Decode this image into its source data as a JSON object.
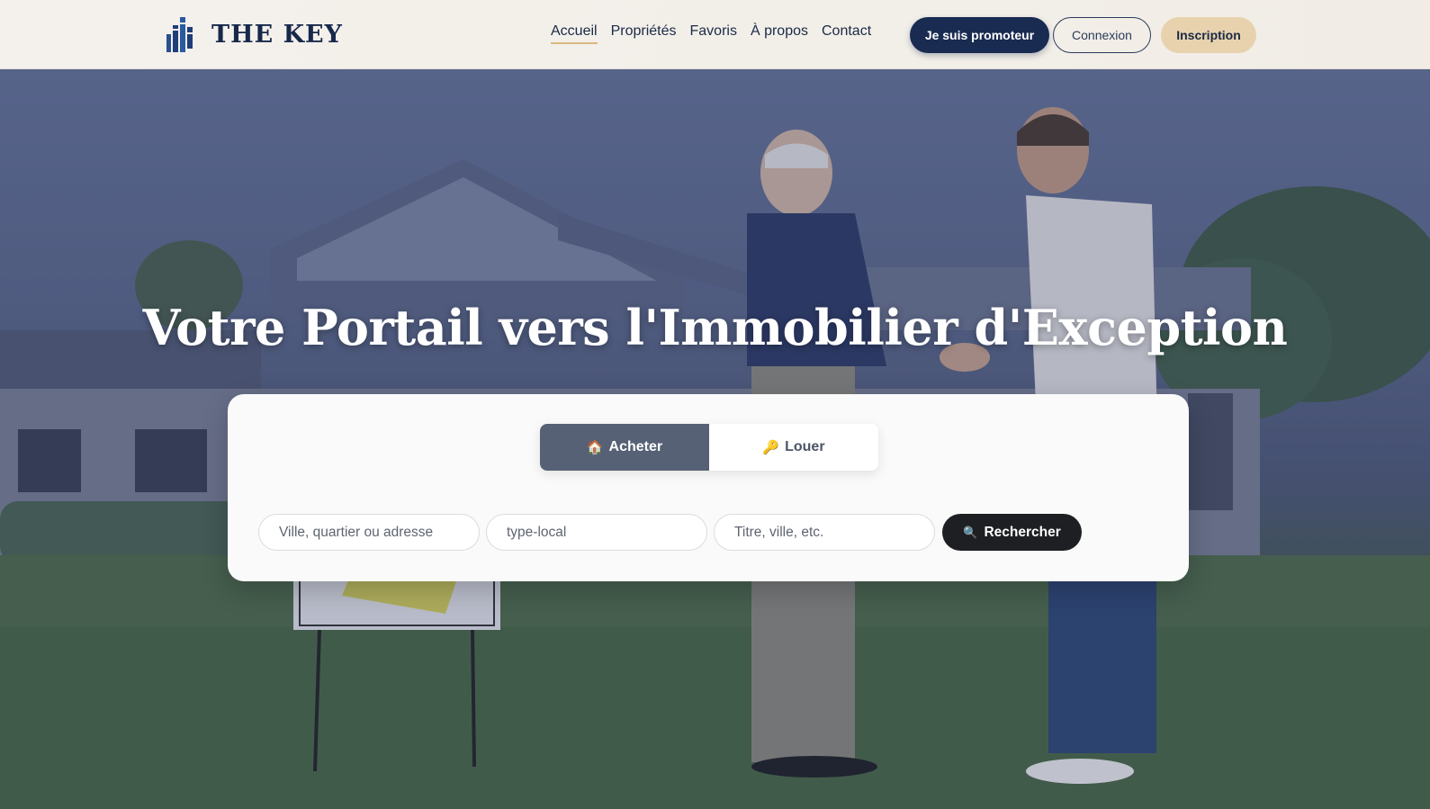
{
  "brand": {
    "name": "THE KEY",
    "icon": "building-logo-icon"
  },
  "nav": {
    "items": [
      {
        "label": "Accueil",
        "active": true
      },
      {
        "label": "Propriétés",
        "active": false
      },
      {
        "label": "Favoris",
        "active": false
      },
      {
        "label": "À propos",
        "active": false
      },
      {
        "label": "Contact",
        "active": false
      }
    ]
  },
  "actions": {
    "promoter_label": "Je suis promoteur",
    "login_label": "Connexion",
    "signup_label": "Inscription"
  },
  "hero": {
    "title": "Votre Portail vers l'Immobilier d'Exception",
    "image": "handshake-in-front-of-house-photo"
  },
  "search": {
    "tabs": [
      {
        "label": "Acheter",
        "icon": "🏠",
        "active": true
      },
      {
        "label": "Louer",
        "icon": "🔑",
        "active": false
      }
    ],
    "fields": [
      {
        "placeholder": "Ville, quartier ou adresse",
        "value": ""
      },
      {
        "placeholder": "type-local",
        "value": ""
      },
      {
        "placeholder": "Titre, ville, etc.",
        "value": ""
      }
    ],
    "submit_label": "Rechercher",
    "submit_icon": "🔍"
  },
  "colors": {
    "navy": "#1a2b52",
    "gold": "#e8d2ae",
    "accent_underline": "#d9b97f",
    "active_tab": "#566175",
    "search_button": "#1d1f22"
  }
}
